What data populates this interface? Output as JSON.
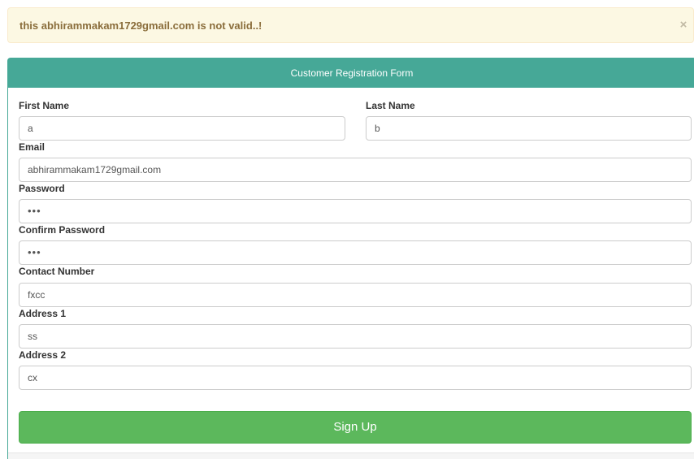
{
  "alert": {
    "message": "this abhirammakam1729gmail.com is not valid..!",
    "close_glyph": "×"
  },
  "form": {
    "title": "Customer Registration Form",
    "first_name": {
      "label": "First Name",
      "value": "a"
    },
    "last_name": {
      "label": "Last Name",
      "value": "b"
    },
    "email": {
      "label": "Email",
      "value": "abhirammakam1729gmail.com"
    },
    "password": {
      "label": "Password",
      "value": "•••"
    },
    "confirm_password": {
      "label": "Confirm Password",
      "value": "•••"
    },
    "contact_number": {
      "label": "Contact Number",
      "value": "fxcc"
    },
    "address1": {
      "label": "Address 1",
      "value": "ss"
    },
    "address2": {
      "label": "Address 2",
      "value": "cx"
    },
    "submit_label": "Sign Up"
  },
  "colors": {
    "alert_bg": "#fcf8e3",
    "alert_text": "#8a6d3b",
    "panel_heading": "#46a897",
    "button": "#5cb85c"
  }
}
